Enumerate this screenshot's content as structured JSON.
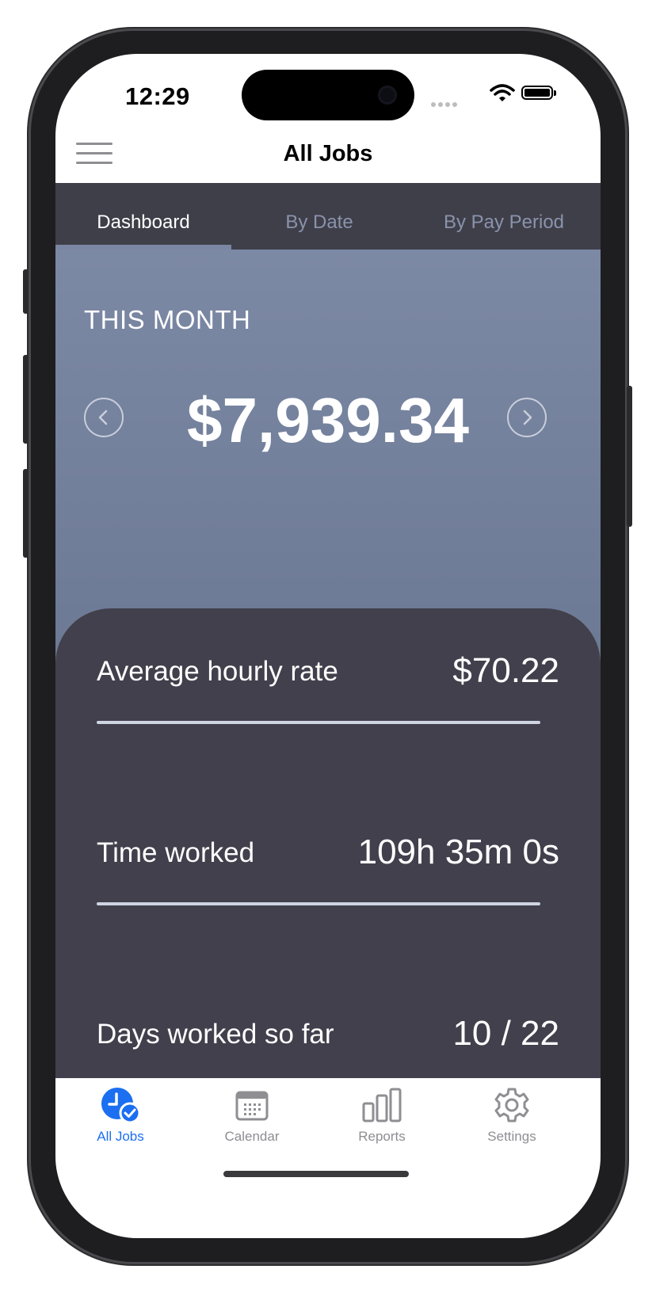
{
  "status_bar": {
    "time": "12:29"
  },
  "nav": {
    "title": "All Jobs"
  },
  "top_tabs": [
    {
      "label": "Dashboard",
      "active": true
    },
    {
      "label": "By Date",
      "active": false
    },
    {
      "label": "By Pay Period",
      "active": false
    }
  ],
  "hero": {
    "period_label": "THIS MONTH",
    "amount": "$7,939.34"
  },
  "stats": [
    {
      "label": "Average hourly rate",
      "value": "$70.22"
    },
    {
      "label": "Time worked",
      "value": "109h 35m 0s"
    },
    {
      "label": "Days worked so far",
      "value": "10 / 22"
    }
  ],
  "bottom_tabs": [
    {
      "label": "All Jobs",
      "icon": "clock-check-icon",
      "active": true
    },
    {
      "label": "Calendar",
      "icon": "calendar-icon",
      "active": false
    },
    {
      "label": "Reports",
      "icon": "bar-chart-icon",
      "active": false
    },
    {
      "label": "Settings",
      "icon": "gear-icon",
      "active": false
    }
  ],
  "colors": {
    "accent": "#1b6ff0",
    "tab_strip": "#3f3f4a",
    "hero": "#7c89a5",
    "card": "#41404c"
  }
}
